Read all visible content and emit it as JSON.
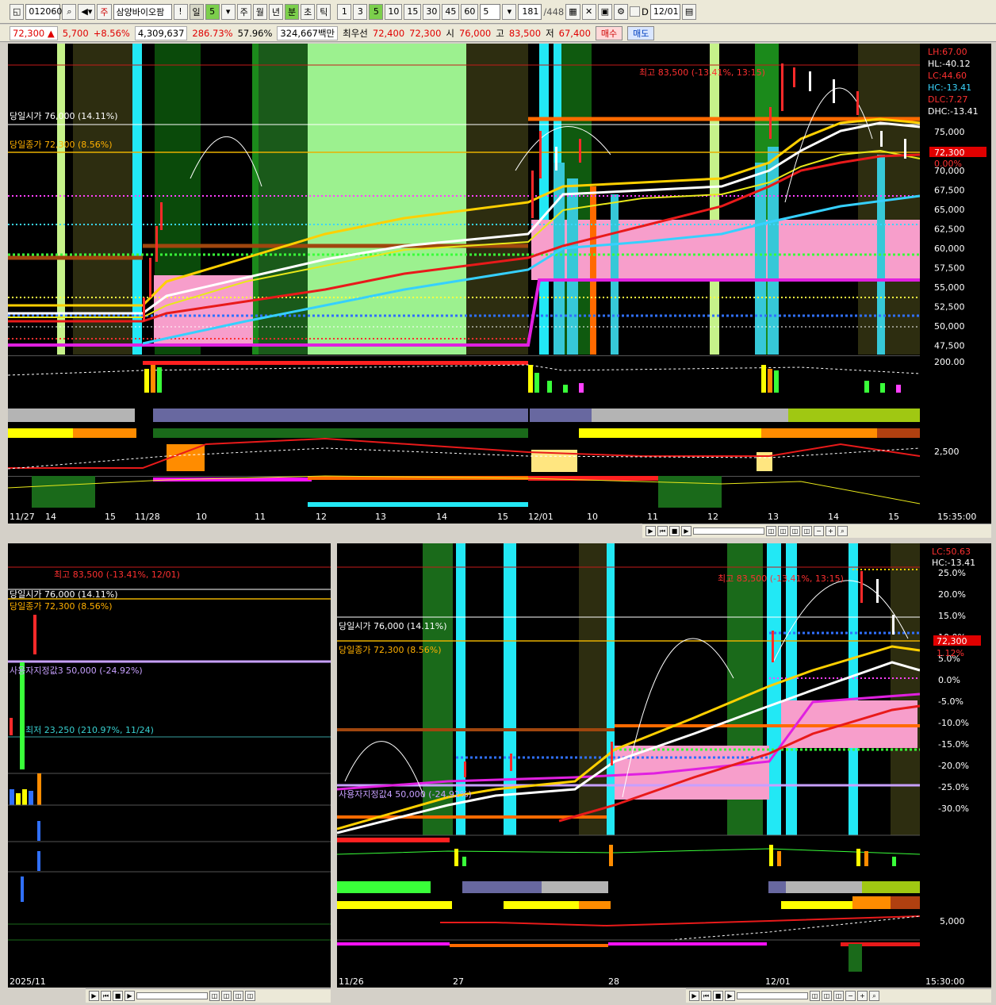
{
  "toolbar": {
    "code": "012060",
    "name": "삼양바이오팜",
    "mode_day": "일",
    "count_5": "5",
    "periods": [
      "주",
      "월",
      "년",
      "분",
      "초",
      "틱"
    ],
    "intervals": [
      "1",
      "3",
      "5",
      "10",
      "15",
      "30",
      "45",
      "60"
    ],
    "interval_sel": "5",
    "bars": "181",
    "bars_total": "/448",
    "date_label": "D",
    "date": "12/01"
  },
  "quote": {
    "price": "72,300 ▲",
    "change": "5,700",
    "pct": "+8.56%",
    "volume": "4,309,637",
    "vol_ratio": "286.73%",
    "turnover": "57.96%",
    "amount": "324,667백만",
    "prio_label": "최우선",
    "prio_ask": "72,400",
    "prio_bid": "72,300",
    "open_label": "시",
    "open": "76,000",
    "high_label": "고",
    "high": "83,500",
    "low_label": "저",
    "low": "67,400",
    "buy": "매수",
    "sell": "매도"
  },
  "main_chart": {
    "labels": {
      "day_open": "당일시가 76,000 (14.11%)",
      "day_close": "당일종가 72,300 (8.56%)",
      "high": "최고 83,500 (-13.41%, 13:15)"
    },
    "price_ticks": [
      "75,000",
      "72,500",
      "70,000",
      "67,500",
      "65,000",
      "62,500",
      "60,000",
      "57,500",
      "55,000",
      "52,500",
      "50,000",
      "47,500"
    ],
    "price_tag": "72,300",
    "pct_tag": "0.00%",
    "stats": [
      "LH:67.00",
      "HL:-40.12",
      "LC:44.60",
      "HC:-13.41",
      "DLC:7.27",
      "DHC:-13.41"
    ],
    "vol_tick": "200.00",
    "osc_tick": "2,500",
    "time_labels": [
      "11/27",
      "14",
      "15",
      "11/28",
      "10",
      "11",
      "12",
      "13",
      "14",
      "15",
      "12/01",
      "10",
      "11",
      "12",
      "13",
      "14",
      "15"
    ],
    "time_right": "15:35:00"
  },
  "left_chart": {
    "labels": {
      "high": "최고 83,500 (-13.41%, 12/01)",
      "day_open": "당일시가 76,000 (14.11%)",
      "day_close": "당일종가 72,300 (8.56%)",
      "user3": "사용자지정값3 50,000 (-24.92%)",
      "low": "최저 23,250 (210.97%, 11/24)"
    },
    "time_label": "2025/11"
  },
  "right_chart": {
    "labels": {
      "high": "최고 83,500 (-13.41%, 13:15)",
      "day_open": "당일시가 76,000 (14.11%)",
      "day_close": "당일종가 72,300 (8.56%)",
      "user": "사용자지정값4 50,000 (-24.92%)"
    },
    "pct_ticks": [
      "25.0%",
      "20.0%",
      "15.0%",
      "10.0%",
      "5.0%",
      "0.0%",
      "-5.0%",
      "-10.0%",
      "-15.0%",
      "-20.0%",
      "-25.0%",
      "-30.0%"
    ],
    "stats": [
      "LC:50.63",
      "HC:-13.41"
    ],
    "price_tag": "72,300",
    "pct_tag": "1.12%",
    "osc_tick": "5,000",
    "time_labels": [
      "11/26",
      "27",
      "28",
      "12/01"
    ],
    "time_right": "15:30:00"
  }
}
